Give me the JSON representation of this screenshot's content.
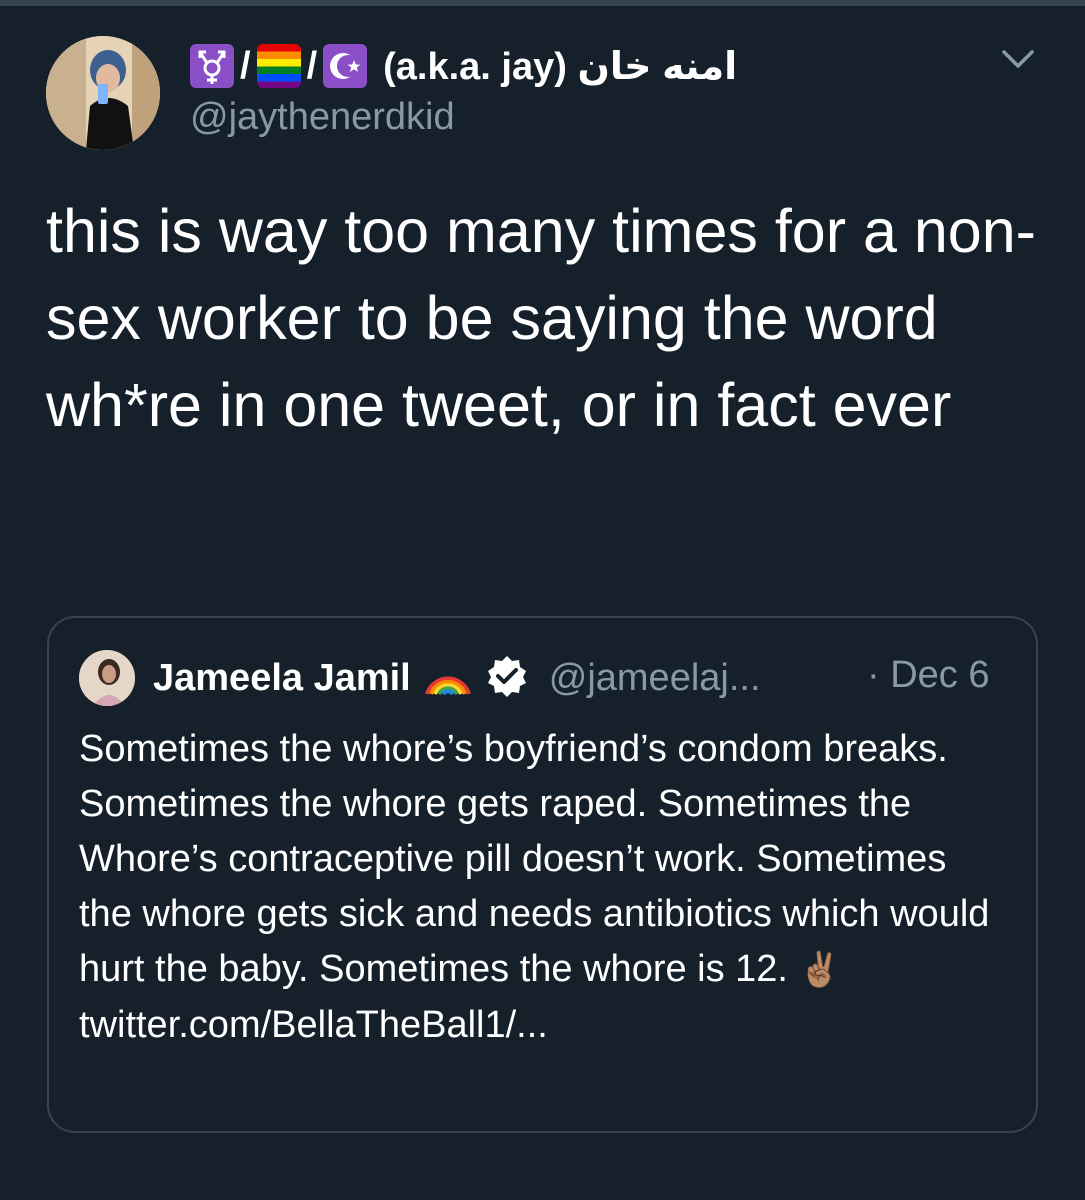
{
  "tweet": {
    "display_name_suffix": "(a.k.a. jay) امنه خان",
    "handle": "@jaythenerdkid",
    "text": "this is way too many times for a non-sex worker to be saying the word wh*re in one tweet, or in fact ever",
    "name_icons": [
      "transgender-symbol-icon",
      "rainbow-flag-icon",
      "star-and-crescent-icon"
    ]
  },
  "quote": {
    "name": "Jameela Jamil",
    "name_emoji": "🌈",
    "verified_icon": "verified-badge-icon",
    "handle": "@jameelaj...",
    "date": "· Dec 6",
    "text": "Sometimes the whore’s boyfriend’s condom breaks. Sometimes the whore gets raped. Sometimes the Whore’s contraceptive pill doesn’t work. Sometimes the whore gets sick and needs antibiotics which would hurt the baby. Sometimes the whore is 12.",
    "emoji": "✌🏽",
    "link": "twitter.com/BellaTheBall1/..."
  },
  "colors": {
    "background": "#15202b",
    "border": "#38444d",
    "secondary_text": "#8899a6",
    "primary_text": "#ffffff"
  }
}
